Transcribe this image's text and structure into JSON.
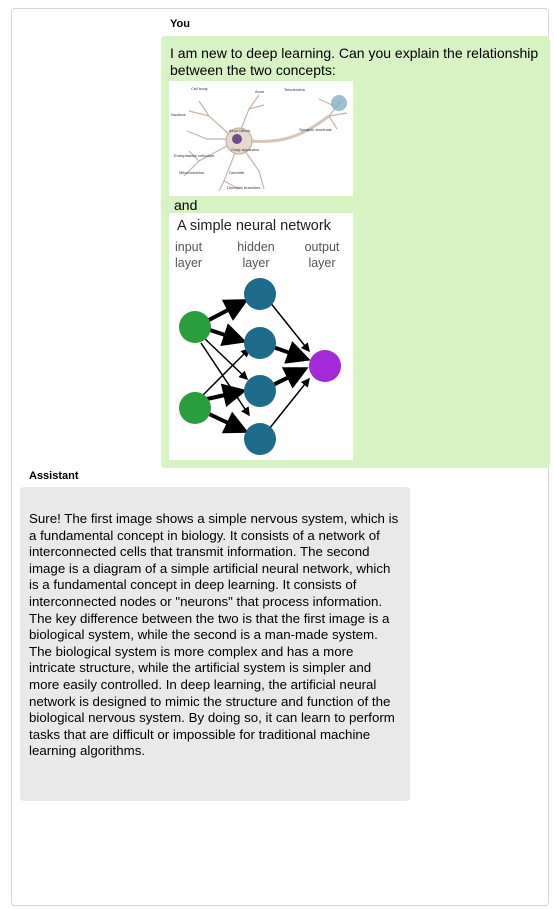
{
  "conversation": {
    "user": {
      "speaker": "You",
      "message": "I am new to deep learning. Can you explain the relationship between the two concepts:",
      "connector": "and",
      "neuron_image": {
        "labels": {
          "cell_body": "Cell body",
          "axon": "Axon",
          "telodendria": "Telodendria",
          "nucleus": "Nucleus",
          "axon_hillock": "Axon hillock",
          "synaptic_terminals": "Synaptic terminals",
          "golgi": "Golgi apparatus",
          "er": "Endoplasmic reticulum",
          "mitochondrion": "Mitochondrion",
          "dendrite": "Dendrite",
          "dendritic_branches": "Dendritic branches"
        }
      },
      "network_image": {
        "title": "A simple neural network",
        "input_label": "input layer",
        "hidden_label": "hidden layer",
        "output_label": "output layer",
        "colors": {
          "input": "#2a9d3f",
          "hidden": "#1f6b8c",
          "output": "#a22ad9"
        }
      }
    },
    "assistant": {
      "speaker": "Assistant",
      "message": "Sure! The first image shows a simple nervous system, which is a fundamental concept in biology. It consists of a network of interconnected cells that transmit information. The second image is a diagram of a simple artificial neural network, which is a fundamental concept in deep learning. It consists of interconnected nodes or \"neurons\" that process information. The key difference between the two is that the first image is a biological system, while the second is a man-made system. The biological system is more complex and has a more intricate structure, while the artificial system is simpler and more easily controlled. In deep learning, the artificial neural network is designed to mimic the structure and function of the biological nervous system. By doing so, it can learn to perform tasks that are difficult or impossible for traditional machine learning algorithms."
    }
  }
}
